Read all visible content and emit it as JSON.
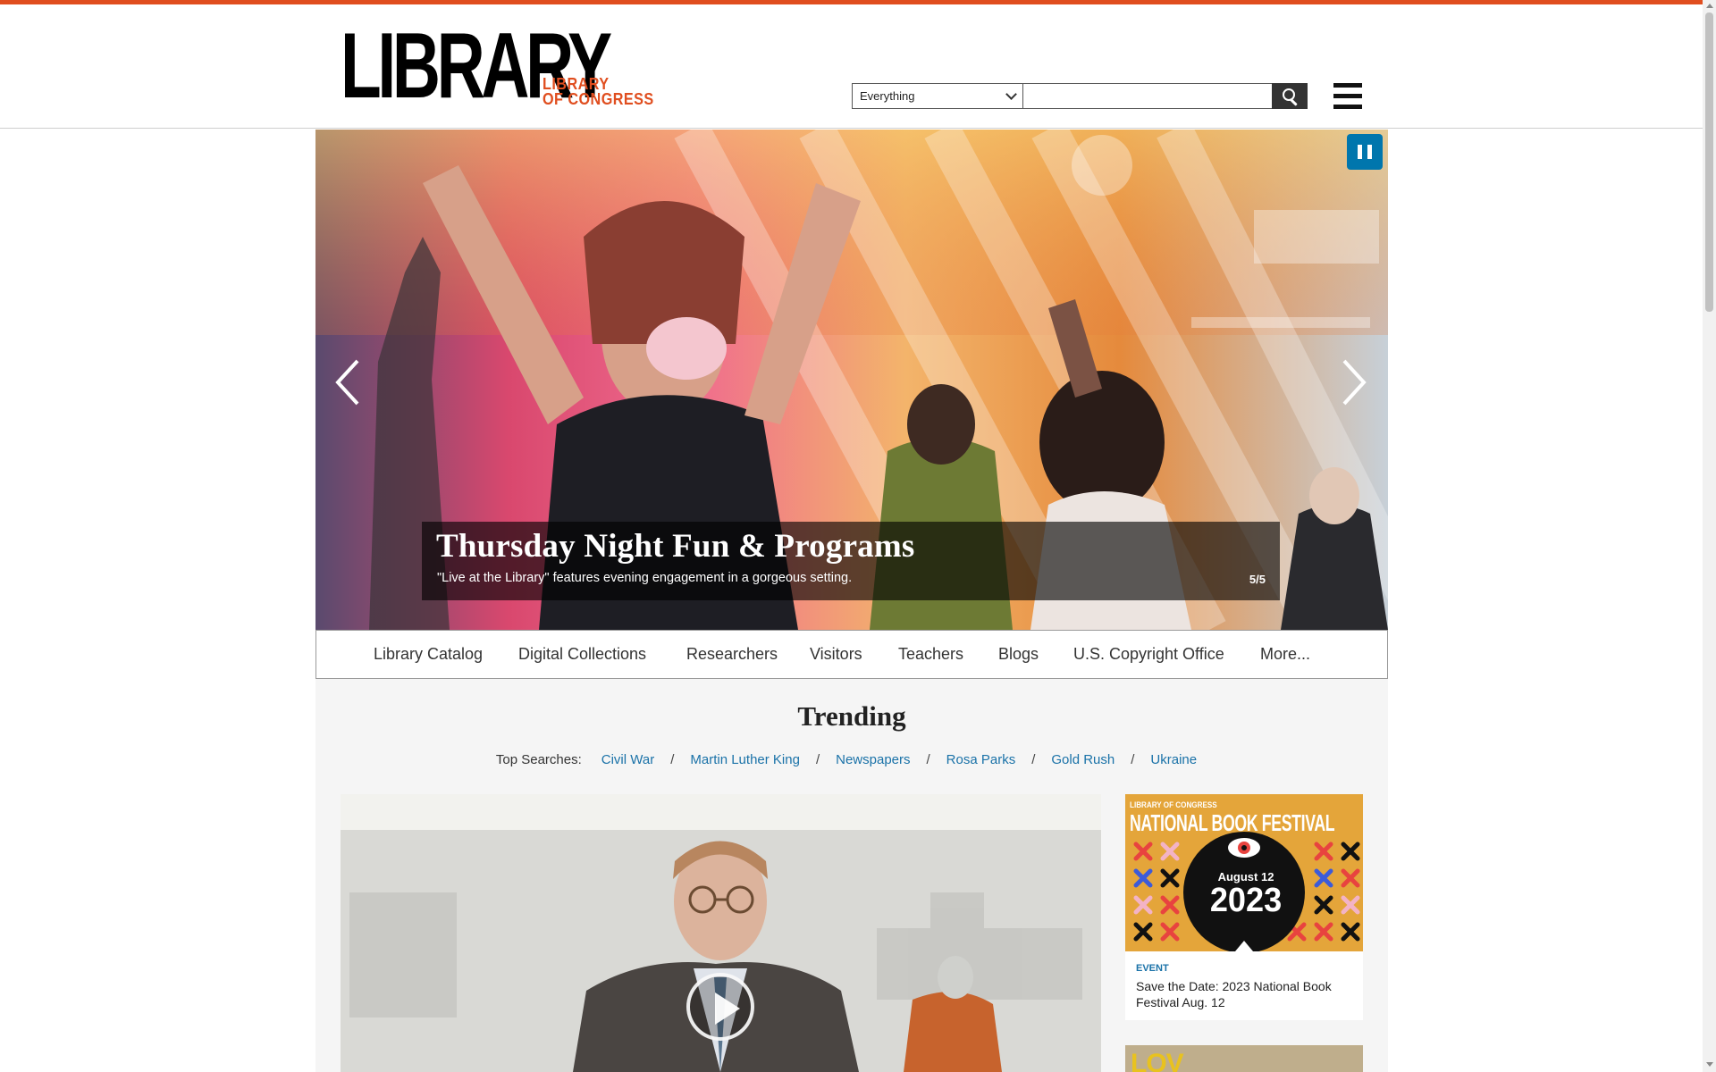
{
  "brand": {
    "logo_main": "LIBRARY",
    "logo_sub_1": "LIBRARY",
    "logo_sub_2": "OF CONGRESS",
    "accent_color": "#e04e1f",
    "link_color": "#1a72a8"
  },
  "search": {
    "scope_selected": "Everything",
    "query": "",
    "button_icon": "search-icon"
  },
  "menu": {
    "icon": "hamburger-menu-icon"
  },
  "carousel": {
    "title": "Thursday Night Fun & Programs",
    "subtitle": "\"Live at the Library\" features evening engagement in a gorgeous setting.",
    "counter": "5/5",
    "pause_icon": "pause-icon",
    "prev_icon": "chevron-left-icon",
    "next_icon": "chevron-right-icon"
  },
  "nav": {
    "items": [
      "Library Catalog",
      "Digital Collections",
      "Researchers",
      "Visitors",
      "Teachers",
      "Blogs",
      "U.S. Copyright Office",
      "More..."
    ]
  },
  "trending": {
    "title": "Trending",
    "top_searches_label": "Top Searches:",
    "searches": [
      "Civil War",
      "Martin Luther King",
      "Newspapers",
      "Rosa Parks",
      "Gold Rush",
      "Ukraine"
    ],
    "separator": "/"
  },
  "video": {
    "play_icon": "play-icon"
  },
  "cards": [
    {
      "image_pretitle": "LIBRARY OF CONGRESS",
      "image_title": "NATIONAL BOOK FESTIVAL",
      "image_date": "August 12",
      "image_year": "2023",
      "tag": "EVENT",
      "title": "Save the Date: 2023 National Book Festival Aug. 12"
    },
    {
      "image_text": "LOV"
    }
  ]
}
